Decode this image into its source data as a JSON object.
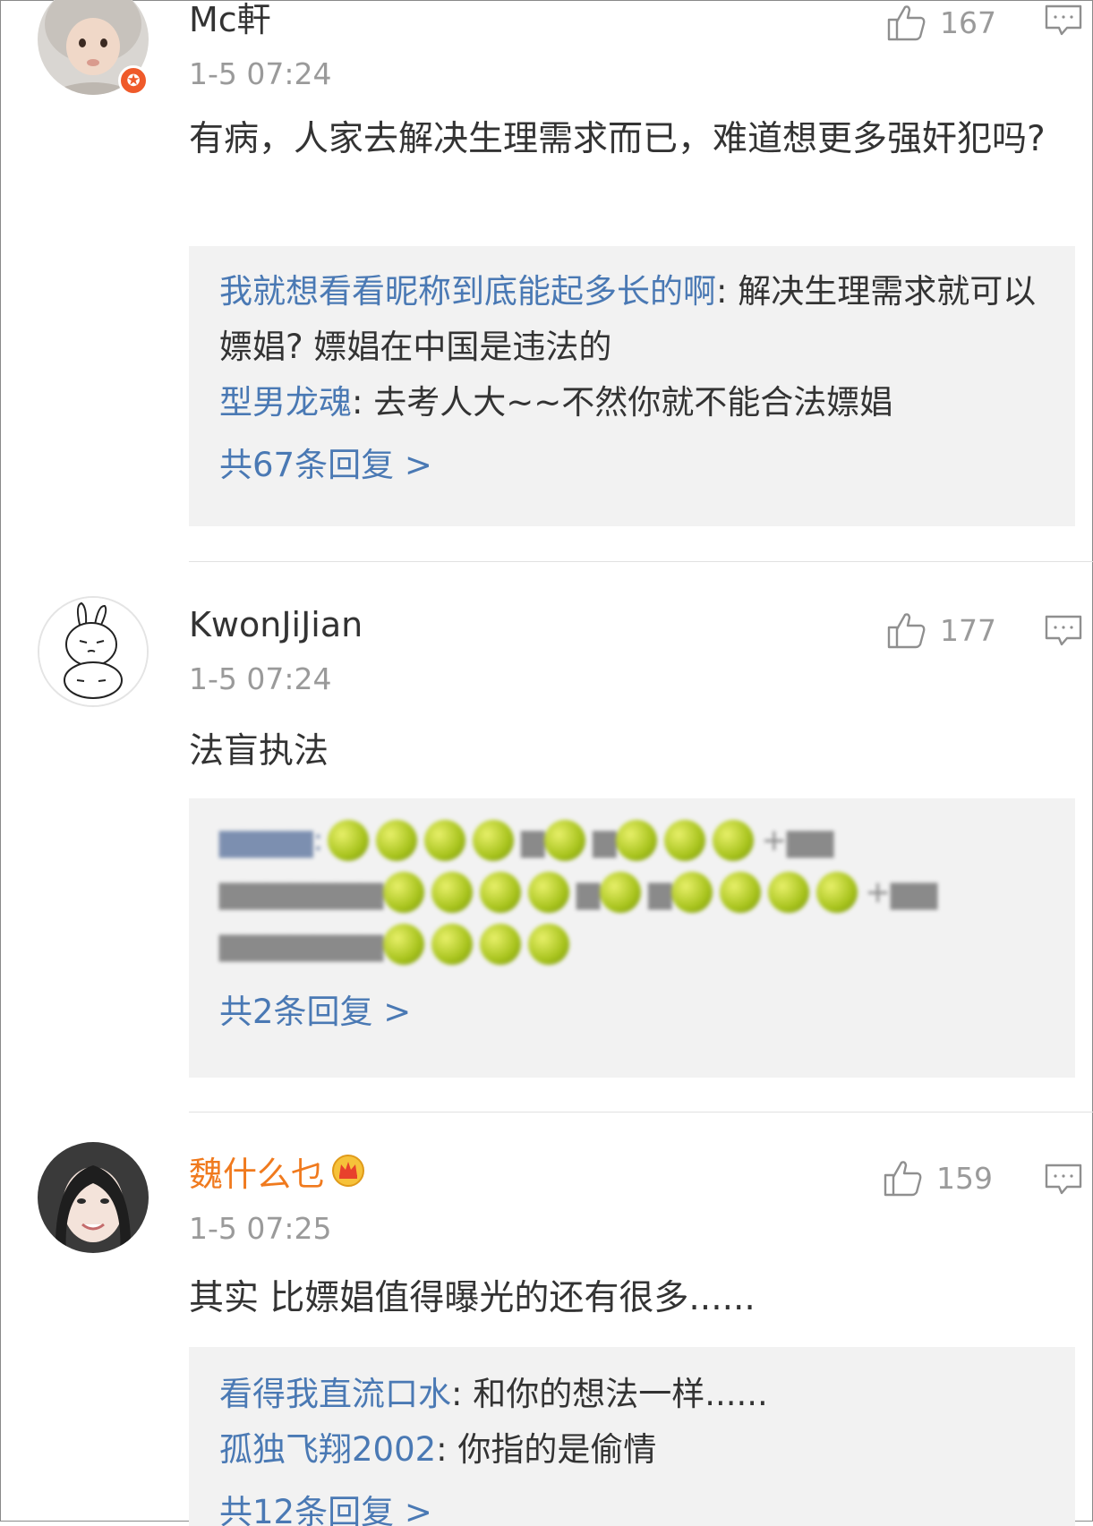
{
  "comments": [
    {
      "user": "Mc軒",
      "time": "1-5 07:24",
      "likes": "167",
      "text": "有病，人家去解决生理需求而已，难道想更多强奸犯吗?",
      "replies": [
        {
          "name": "我就想看看昵称到底能起多长的啊",
          "text": ": 解决生理需求就可以嫖娼? 嫖娼在中国是违法的"
        },
        {
          "name": "型男龙魂",
          "text": ": 去考人大~~不然你就不能合法嫖娼"
        }
      ],
      "more": "共67条回复 >"
    },
    {
      "user": "KwonJiJian",
      "time": "1-5 07:24",
      "likes": "177",
      "text": "法盲执法",
      "more": "共2条回复 >"
    },
    {
      "user": "魏什么乜",
      "time": "1-5 07:25",
      "likes": "159",
      "text": "其实 比嫖娼值得曝光的还有很多......",
      "replies": [
        {
          "name": "看得我直流口水",
          "text": ": 和你的想法一样......"
        },
        {
          "name": "孤独飞翔2002",
          "text": ": 你指的是偷情"
        }
      ],
      "more": "共12条回复 >"
    }
  ],
  "icons": {
    "like": "thumbs-up-icon",
    "reply": "comment-icon",
    "verified": "verified-badge-icon",
    "vip": "crown-icon"
  },
  "colors": {
    "link": "#4a79b4",
    "vip_name": "#f07a1e",
    "meta": "#9a9a9a",
    "reply_bg": "#f2f2f2"
  }
}
